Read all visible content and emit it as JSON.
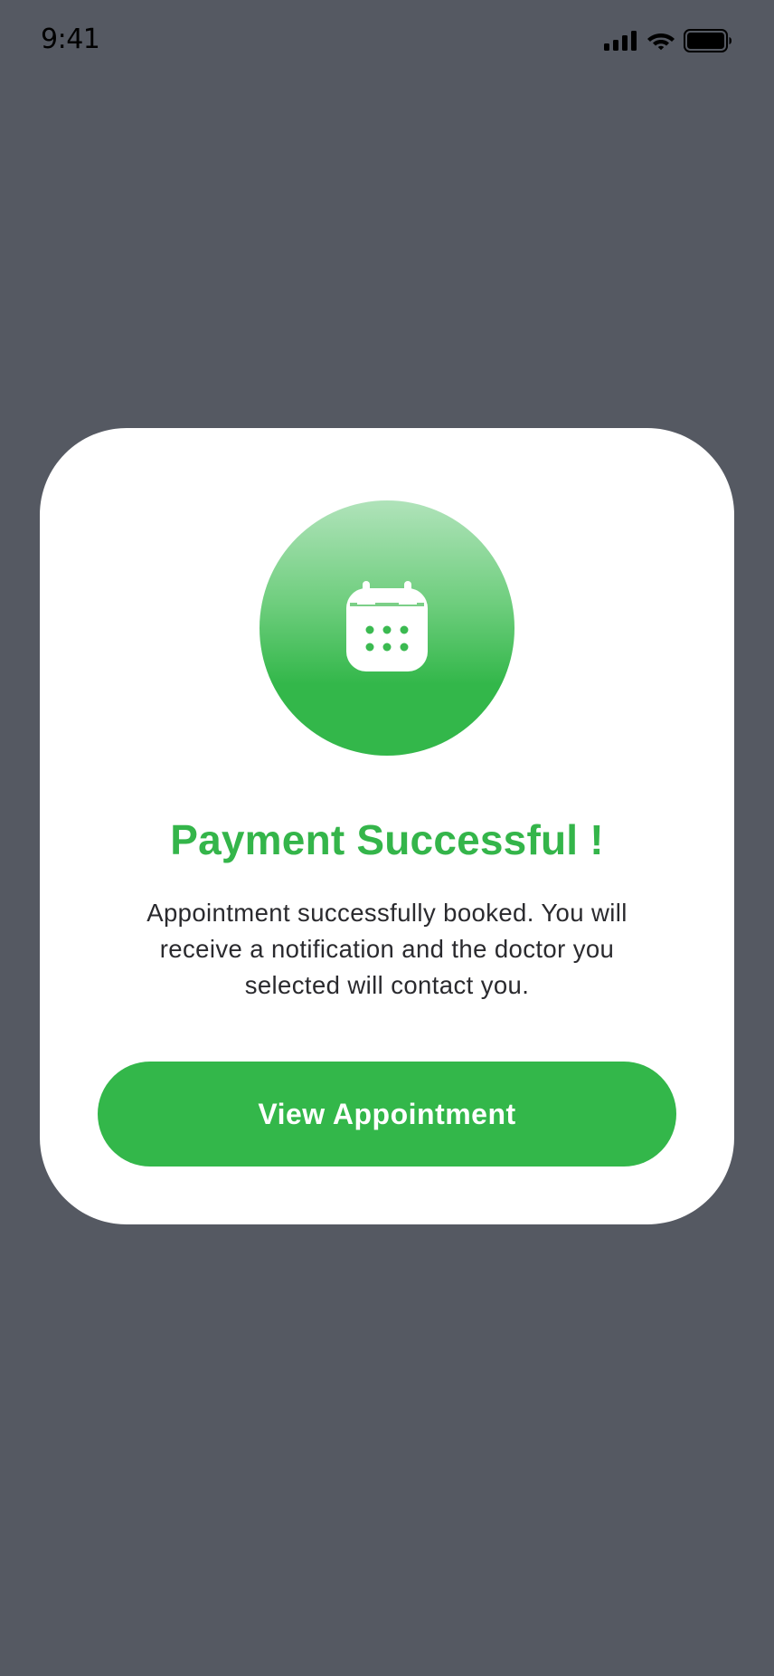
{
  "status_bar": {
    "time": "9:41",
    "icons": [
      "cellular-signal-icon",
      "wifi-icon",
      "battery-icon"
    ]
  },
  "modal": {
    "icon": "calendar-icon",
    "title": "Payment Successful !",
    "message": "Appointment successfully booked. You will receive a notification and the doctor you selected will contact you.",
    "button_label": "View Appointment"
  },
  "colors": {
    "backdrop": "#555962",
    "card": "#ffffff",
    "accent_green": "#33b74a",
    "title_green": "#34b54a",
    "body_text": "#2a2a2e"
  }
}
